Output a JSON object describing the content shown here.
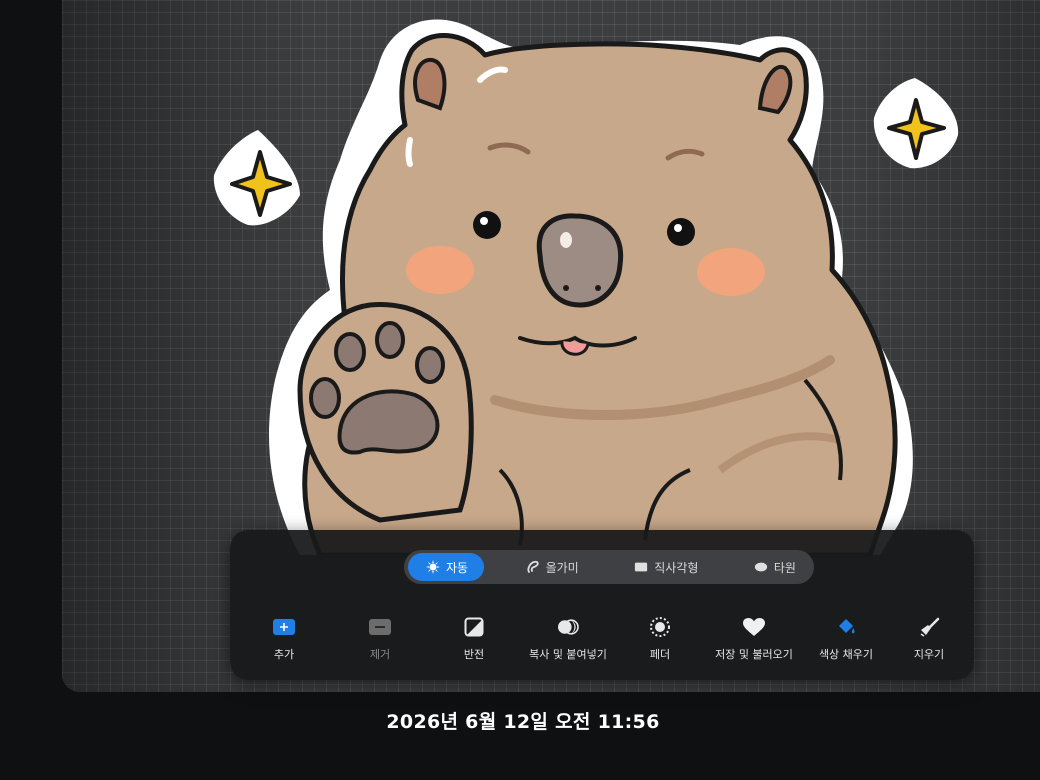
{
  "mode_bar": {
    "selected": "자동",
    "modes": [
      {
        "label": "자동",
        "icon": "burst-icon"
      },
      {
        "label": "올가미",
        "icon": "lasso-icon"
      },
      {
        "label": "직사각형",
        "icon": "rectangle-icon"
      },
      {
        "label": "타원",
        "icon": "ellipse-icon"
      }
    ]
  },
  "tools": [
    {
      "label": "추가",
      "icon": "plus-square-icon",
      "state": "selected",
      "color": "#1f7fe6"
    },
    {
      "label": "제거",
      "icon": "minus-square-icon",
      "state": "disabled"
    },
    {
      "label": "반전",
      "icon": "invert-icon"
    },
    {
      "label": "복사 및 붙여넣기",
      "icon": "copy-paste-icon"
    },
    {
      "label": "페더",
      "icon": "feather-icon"
    },
    {
      "label": "저장 및 불러오기",
      "icon": "heart-icon"
    },
    {
      "label": "색상 채우기",
      "icon": "fill-bucket-icon",
      "color": "#1f7fe6"
    },
    {
      "label": "지우기",
      "icon": "eraser-icon"
    }
  ],
  "timestamp": "2026년 6월 12일 오전 11:56"
}
